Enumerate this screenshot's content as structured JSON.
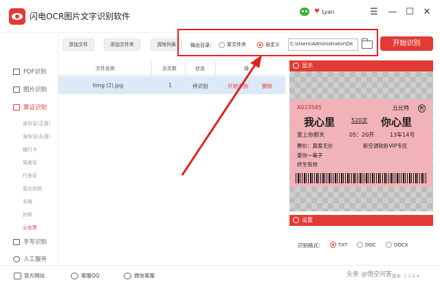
{
  "app": {
    "title": "闪电OCR图片文字识别软件",
    "user": "Lyan"
  },
  "window": {
    "minimize": "—",
    "maximize": "☐",
    "close": "✕",
    "menu": "☰"
  },
  "sidebar": {
    "items": [
      {
        "label": "PDF识别"
      },
      {
        "label": "图片识别"
      },
      {
        "label": "票证识别"
      },
      {
        "label": "手写识别"
      },
      {
        "label": "人工服务"
      }
    ],
    "subitems": [
      "身份证(正面)",
      "身份证(反面)",
      "银行卡",
      "驾驶证",
      "行驶证",
      "营业执照",
      "车牌",
      "护照",
      "火车票"
    ]
  },
  "toolbar": {
    "add_file": "添加文件",
    "add_folder": "添加文件夹",
    "clear_list": "清除列表"
  },
  "output": {
    "label": "输出目录：",
    "option_source": "原文件夹",
    "option_custom": "自定义",
    "path": "C:\\Users\\Administrator\\De",
    "start": "开始识别"
  },
  "table": {
    "headers": [
      "文件名称",
      "总页数",
      "状态",
      "操"
    ],
    "rows": [
      {
        "name": "timg (2).jpg",
        "pages": "1",
        "status": "待识别",
        "action_start": "开始识别",
        "action_delete": "删除"
      }
    ]
  },
  "preview": {
    "title": "显示",
    "ticket": {
      "serial": "A023585",
      "gate": "丘比特",
      "sale": "售",
      "from": "我心里",
      "train": "520次",
      "to": "你心里",
      "line1a": "爱上你那天",
      "line1b": "05：20开",
      "line1c": "13车14号",
      "line2a": "票价：真爱无价",
      "line2b": "新空调软卧VIP专区",
      "line3": "爱你一辈子",
      "line4": "终生有效"
    }
  },
  "settings": {
    "title": "设置",
    "format_label": "识别格式：",
    "formats": [
      "TXT",
      "DOC",
      "DOCX"
    ],
    "selected": "TXT"
  },
  "footer": {
    "website": "官方网站",
    "qq": "客服QQ",
    "wechat": "微信客服",
    "version": "版本: 1.2.2.4"
  },
  "watermark": "头条 @悟空问答",
  "colors": {
    "accent": "#e23b35",
    "selected_row": "#dce9f9",
    "annotation": "#e32020"
  }
}
